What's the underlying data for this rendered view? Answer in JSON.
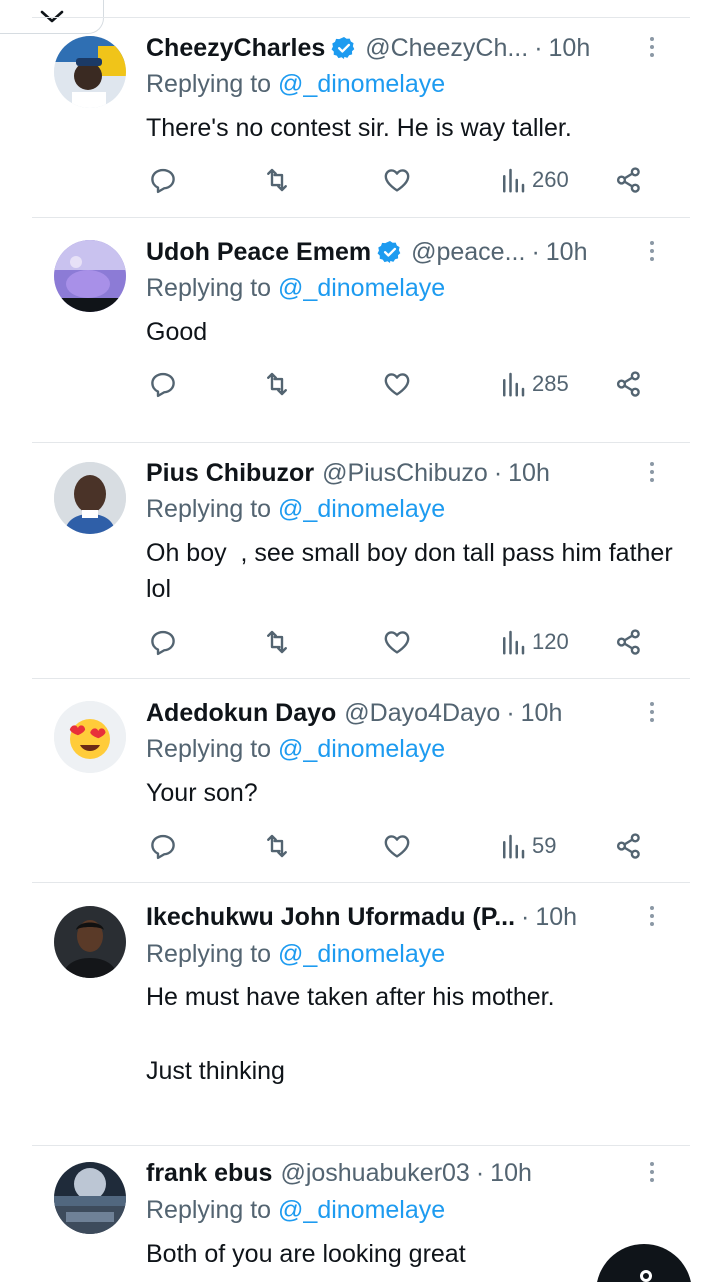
{
  "replies": [
    {
      "name": "CheezyCharles",
      "verified": true,
      "handle": "@CheezyCh...",
      "time": "10h",
      "replying_prefix": "Replying to",
      "replying_to": "@_dinomelaye",
      "text": "There's no contest sir. He is way taller.",
      "views": "260"
    },
    {
      "name": "Udoh Peace Emem",
      "verified": true,
      "handle": "@peace...",
      "time": "10h",
      "replying_prefix": "Replying to",
      "replying_to": "@_dinomelaye",
      "text": "Good",
      "views": "285"
    },
    {
      "name": "Pius Chibuzor",
      "verified": false,
      "handle": "@PiusChibuzo",
      "time": "10h",
      "replying_prefix": "Replying to",
      "replying_to": "@_dinomelaye",
      "text": "Oh boy  , see small boy don tall pass him father lol",
      "views": "120"
    },
    {
      "name": "Adedokun Dayo",
      "verified": false,
      "handle": "@Dayo4Dayo",
      "time": "10h",
      "replying_prefix": "Replying to",
      "replying_to": "@_dinomelaye",
      "text": "Your son?",
      "views": "59"
    },
    {
      "name": "Ikechukwu John Uformadu (P...",
      "verified": false,
      "handle": "",
      "time": "10h",
      "replying_prefix": "Replying to",
      "replying_to": "@_dinomelaye",
      "text": "He must have taken after his mother.",
      "text2": "Just thinking"
    },
    {
      "name": "frank ebus",
      "verified": false,
      "handle": "@joshuabuker03",
      "time": "10h",
      "replying_prefix": "Replying to",
      "replying_to": "@_dinomelaye",
      "text": "Both of you are looking great"
    }
  ],
  "icons": {
    "collapse": "chevron-down-icon",
    "reply": "comment-icon",
    "retweet": "retweet-icon",
    "like": "heart-icon",
    "views": "analytics-icon",
    "share": "share-icon",
    "verified": "verified-badge-icon"
  },
  "colors": {
    "mention": "#1d9bf0",
    "secondary_text": "#536471",
    "verified_badge": "#1d9bf0"
  }
}
